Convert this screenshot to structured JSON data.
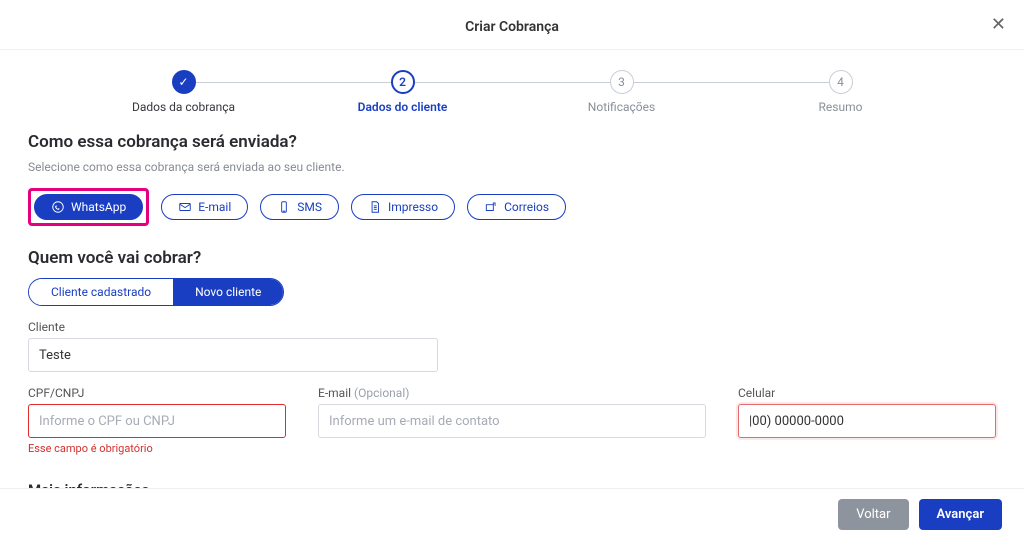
{
  "modal": {
    "title": "Criar Cobrança"
  },
  "stepper": {
    "steps": [
      {
        "label": "Dados da cobrança",
        "state": "done"
      },
      {
        "label": "Dados do cliente",
        "num": "2",
        "state": "active"
      },
      {
        "label": "Notificações",
        "num": "3",
        "state": "pending"
      },
      {
        "label": "Resumo",
        "num": "4",
        "state": "pending"
      }
    ]
  },
  "send": {
    "heading": "Como essa cobrança será enviada?",
    "hint": "Selecione como essa cobrança será enviada ao seu cliente.",
    "channels": {
      "whatsapp": "WhatsApp",
      "email": "E-mail",
      "sms": "SMS",
      "impresso": "Impresso",
      "correios": "Correios"
    }
  },
  "who": {
    "heading": "Quem você vai cobrar?",
    "seg": {
      "existing": "Cliente cadastrado",
      "new": "Novo cliente"
    }
  },
  "form": {
    "cliente": {
      "label": "Cliente",
      "value": "Teste"
    },
    "cpf": {
      "label": "CPF/CNPJ",
      "placeholder": "Informe o CPF ou CNPJ",
      "error": "Esse campo é obrigatório"
    },
    "email": {
      "label": "E-mail",
      "opt": "(Opcional)",
      "placeholder": "Informe um e-mail de contato"
    },
    "celular": {
      "label": "Celular",
      "value": "|00) 00000-0000"
    }
  },
  "more": {
    "label": "Mais informações"
  },
  "footer": {
    "back": "Voltar",
    "next": "Avançar"
  }
}
